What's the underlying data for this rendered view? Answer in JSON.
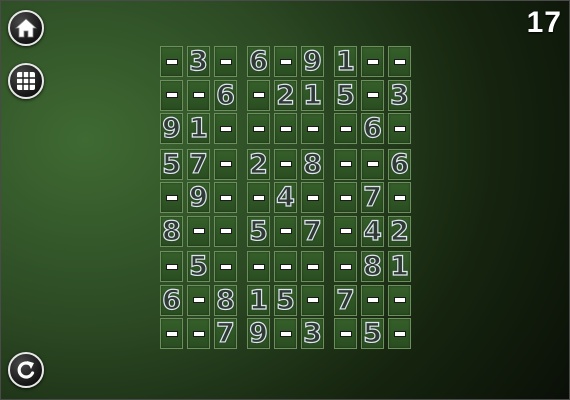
{
  "counter": "17",
  "buttons": [
    {
      "name": "home-button",
      "icon": "home-icon"
    },
    {
      "name": "grid-button",
      "icon": "grid-icon"
    },
    {
      "name": "undo-button",
      "icon": "undo-icon"
    }
  ],
  "board": {
    "empty_symbol": "",
    "rows": [
      [
        "",
        "3",
        "",
        "6",
        "",
        "9",
        "1",
        "",
        ""
      ],
      [
        "",
        "",
        "6",
        "",
        "2",
        "1",
        "5",
        "",
        "3"
      ],
      [
        "9",
        "1",
        "",
        "",
        "",
        "",
        "",
        "6",
        ""
      ],
      [
        "5",
        "7",
        "",
        "2",
        "",
        "8",
        "",
        "",
        "6"
      ],
      [
        "",
        "9",
        "",
        "",
        "4",
        "",
        "",
        "7",
        ""
      ],
      [
        "8",
        "",
        "",
        "5",
        "",
        "7",
        "",
        "4",
        "2"
      ],
      [
        "",
        "5",
        "",
        "",
        "",
        "",
        "",
        "8",
        "1"
      ],
      [
        "6",
        "",
        "8",
        "1",
        "5",
        "",
        "7",
        "",
        ""
      ],
      [
        "",
        "",
        "7",
        "9",
        "",
        "3",
        "",
        "5",
        ""
      ]
    ]
  },
  "colors": {
    "background": "#2c4a24",
    "cell": "#355f2a",
    "cell_border": "#6d8f5e",
    "digit_fill": "#2e3a33",
    "digit_outline": "#dfe6f0"
  }
}
